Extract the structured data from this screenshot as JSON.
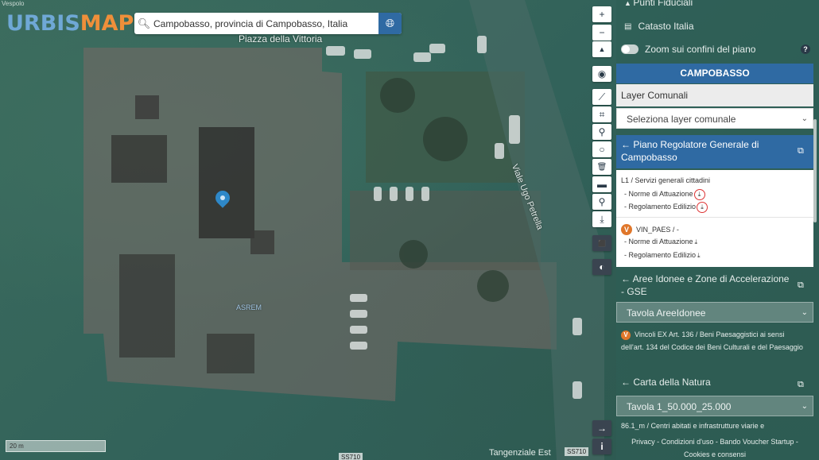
{
  "map": {
    "corner_text": "Vespolo",
    "brand_part1": "URBIS",
    "brand_part2": "MAP",
    "search_value": "Campobasso, provincia di Campobasso, Italia",
    "label_piazza": "Piazza della Vittoria",
    "label_street": "Viale Ugo Petrella",
    "label_building": "ASREM",
    "scale_text": "20 m",
    "attr_esri": "Tangenziale Est",
    "attr_ss1": "SS710",
    "attr_ss2": "SS710"
  },
  "tools": {
    "zoom_in": "+",
    "zoom_out": "−",
    "north": "▲",
    "locate": "◉",
    "measure": "⟋",
    "crop": "⌗",
    "marker": "⚲",
    "circle": "○",
    "delete": "🗑",
    "print": "▬",
    "pin": "⚲",
    "download": "⤓",
    "bookmark": "⬛",
    "layers": "◐",
    "arrow": "→",
    "info": "i"
  },
  "panel": {
    "punti_fiduciali": "Punti Fiduciali",
    "catasto_italia": "Catasto Italia",
    "zoom_confini": "Zoom sui confini del piano",
    "help": "?",
    "city_header": "CAMPOBASSO",
    "layer_comunali": "Layer Comunali",
    "select_layer": "Seleziona layer comunale",
    "prg_title": "← Piano Regolatore Generale di Campobasso",
    "l1_title": "L1 / Servizi generali cittadini",
    "l1_norme": "- Norme di Attuazione",
    "l1_regolamento": "- Regolamento Edilizio",
    "vin_badge": "V",
    "vin_title": "VIN_PAES / -",
    "vin_norme": "- Norme di Attuazione",
    "vin_regolamento": "- Regolamento Edilizio",
    "download_glyph": "⤓",
    "gse_title": "← Aree Idonee e Zone di Accelerazione - GSE",
    "tavola_aree": "Tavola AreeIdonee",
    "vincoli_badge": "V",
    "vincoli_text": "Vincoli EX Art. 136 / Beni Paesaggistici ai sensi dell'art. 134 del Codice dei Beni Culturali e del Paesaggio",
    "carta_natura": "← Carta della Natura",
    "tavola_natura": "Tavola 1_50.000_25.000",
    "aree_text": "86.1_m / Centri abitati e infrastrutture viarie e",
    "footer_line1": "Privacy - Condizioni d'uso - Bando Voucher Startup -",
    "footer_line2": "Cookies e consensi"
  },
  "colors": {
    "header_blue": "#2f6aa3",
    "brand_blue": "#6fa8d6",
    "brand_orange": "#ef8f3a",
    "badge_orange": "#e0772b"
  }
}
